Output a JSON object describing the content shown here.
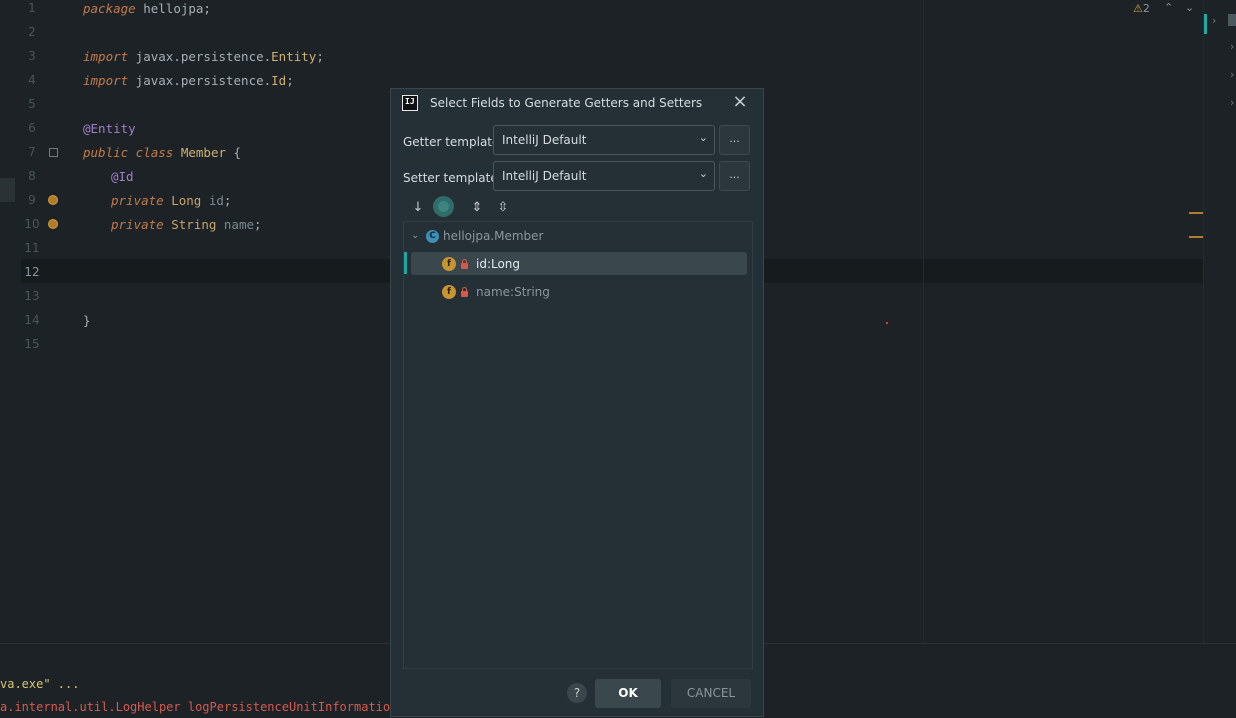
{
  "editor": {
    "line_numbers": [
      "1",
      "2",
      "3",
      "4",
      "5",
      "6",
      "7",
      "8",
      "9",
      "10",
      "11",
      "12",
      "13",
      "14",
      "15"
    ],
    "lines": {
      "l1": {
        "kw": "package",
        "rest": " hellojpa;"
      },
      "l3": {
        "kw": "import",
        "pkg": " javax.persistence.",
        "cls": "Entity",
        "end": ";"
      },
      "l4": {
        "kw": "import",
        "pkg": " javax.persistence.",
        "cls": "Id",
        "end": ";"
      },
      "l6": {
        "ann": "@Entity"
      },
      "l7": {
        "kw1": "public",
        "kw2": " class",
        "name": " Member",
        "end": " {"
      },
      "l8": {
        "ann": "@Id"
      },
      "l9": {
        "kw": "private",
        "type": " Long",
        "id": " id",
        "end": ";"
      },
      "l10": {
        "kw": "private",
        "type": " String",
        "id": " name",
        "end": ";"
      },
      "l14": {
        "text": "}"
      }
    },
    "warning_count": "2",
    "warning_icon": "warning-icon"
  },
  "console": {
    "line1": "va.exe\" ...",
    "line2": "a.internal.util.LogHelper logPersistenceUnitInformation"
  },
  "dialog": {
    "title": "Select Fields to Generate Getters and Setters",
    "getter_label": "Getter template:",
    "getter_value": "IntelliJ Default",
    "setter_label": "Setter template:",
    "setter_value": "IntelliJ Default",
    "more_label": "...",
    "logo_text": "IJ",
    "tree": {
      "class_node": "hellojpa.Member",
      "class_badge": "C",
      "fields": [
        {
          "label": "id:Long",
          "badge": "f",
          "selected": true
        },
        {
          "label": "name:String",
          "badge": "f",
          "selected": false
        }
      ]
    },
    "ok_label": "OK",
    "cancel_label": "CANCEL",
    "help_label": "?"
  },
  "colors": {
    "accent": "#1fa7a0",
    "background": "#1c2226",
    "dialog_bg": "#253036"
  }
}
